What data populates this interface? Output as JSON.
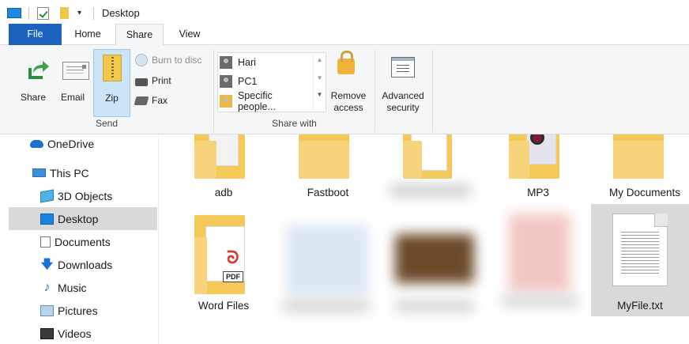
{
  "window": {
    "title": "Desktop"
  },
  "tabs": [
    {
      "label": "File"
    },
    {
      "label": "Home"
    },
    {
      "label": "Share"
    },
    {
      "label": "View"
    }
  ],
  "ribbon": {
    "send_group": {
      "label": "Send",
      "share": "Share",
      "email": "Email",
      "zip": "Zip",
      "burn": "Burn to disc",
      "print": "Print",
      "fax": "Fax"
    },
    "sharewith_group": {
      "label": "Share with",
      "items": [
        "Hari",
        "PC1",
        "Specific people..."
      ],
      "remove_access": "Remove\naccess",
      "advanced_security": "Advanced\nsecurity"
    }
  },
  "nav": {
    "items": [
      {
        "label": "OneDrive",
        "icon": "cloud-icon"
      },
      {
        "label": "This PC",
        "icon": "computer-icon"
      },
      {
        "label": "3D Objects",
        "icon": "cube-icon"
      },
      {
        "label": "Desktop",
        "icon": "desktop-icon",
        "selected": true
      },
      {
        "label": "Documents",
        "icon": "documents-icon"
      },
      {
        "label": "Downloads",
        "icon": "download-icon"
      },
      {
        "label": "Music",
        "icon": "music-icon"
      },
      {
        "label": "Pictures",
        "icon": "pictures-icon"
      },
      {
        "label": "Videos",
        "icon": "videos-icon"
      }
    ]
  },
  "files": {
    "row1": [
      "adb",
      "Fastboot",
      "",
      "MP3",
      "My Documents"
    ],
    "row2": [
      "Word Files",
      "",
      "",
      "",
      "MyFile.txt"
    ]
  },
  "colors": {
    "accent": "#1b63bf",
    "selected": "#d9d9d9",
    "folder": "#f5c85a"
  }
}
